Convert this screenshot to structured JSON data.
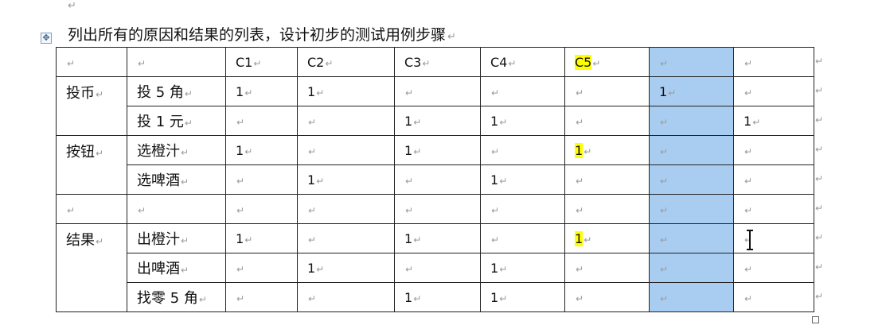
{
  "heading": "列出所有的原因和结果的列表，设计初步的测试用例步骤",
  "para_mark": "↵",
  "icons": {
    "move_handle": "four-arrow-move-icon",
    "cursor": "text-ibeam-cursor-icon",
    "resize": "resize-handle-icon"
  },
  "colors": {
    "selected_column": "#a9cdf0",
    "highlight": "#ffff00"
  },
  "table": {
    "header": [
      "",
      "",
      "C1",
      "C2",
      "C3",
      "C4",
      "C5",
      "",
      ""
    ],
    "groups": [
      {
        "label": "投币",
        "rows": [
          {
            "label": "投 5 角",
            "cells": [
              "1",
              "1",
              "",
              "",
              "",
              "1",
              ""
            ]
          },
          {
            "label": "投 1 元",
            "cells": [
              "",
              "",
              "1",
              "1",
              "",
              "",
              "1"
            ]
          }
        ]
      },
      {
        "label": "按钮",
        "rows": [
          {
            "label": "选橙汁",
            "cells": [
              "1",
              "",
              "1",
              "",
              "1",
              "",
              ""
            ]
          },
          {
            "label": "选啤酒",
            "cells": [
              "",
              "1",
              "",
              "1",
              "",
              "",
              ""
            ]
          }
        ]
      },
      {
        "label": "",
        "rows": [
          {
            "label": "",
            "cells": [
              "",
              "",
              "",
              "",
              "",
              "",
              ""
            ]
          }
        ]
      },
      {
        "label": "结果",
        "rows": [
          {
            "label": "出橙汁",
            "cells": [
              "1",
              "",
              "1",
              "",
              "1",
              "",
              ""
            ]
          },
          {
            "label": "出啤酒",
            "cells": [
              "",
              "1",
              "",
              "1",
              "",
              "",
              ""
            ]
          },
          {
            "label": "找零 5 角",
            "cells": [
              "",
              "",
              "1",
              "1",
              "",
              "",
              ""
            ]
          }
        ]
      }
    ]
  }
}
